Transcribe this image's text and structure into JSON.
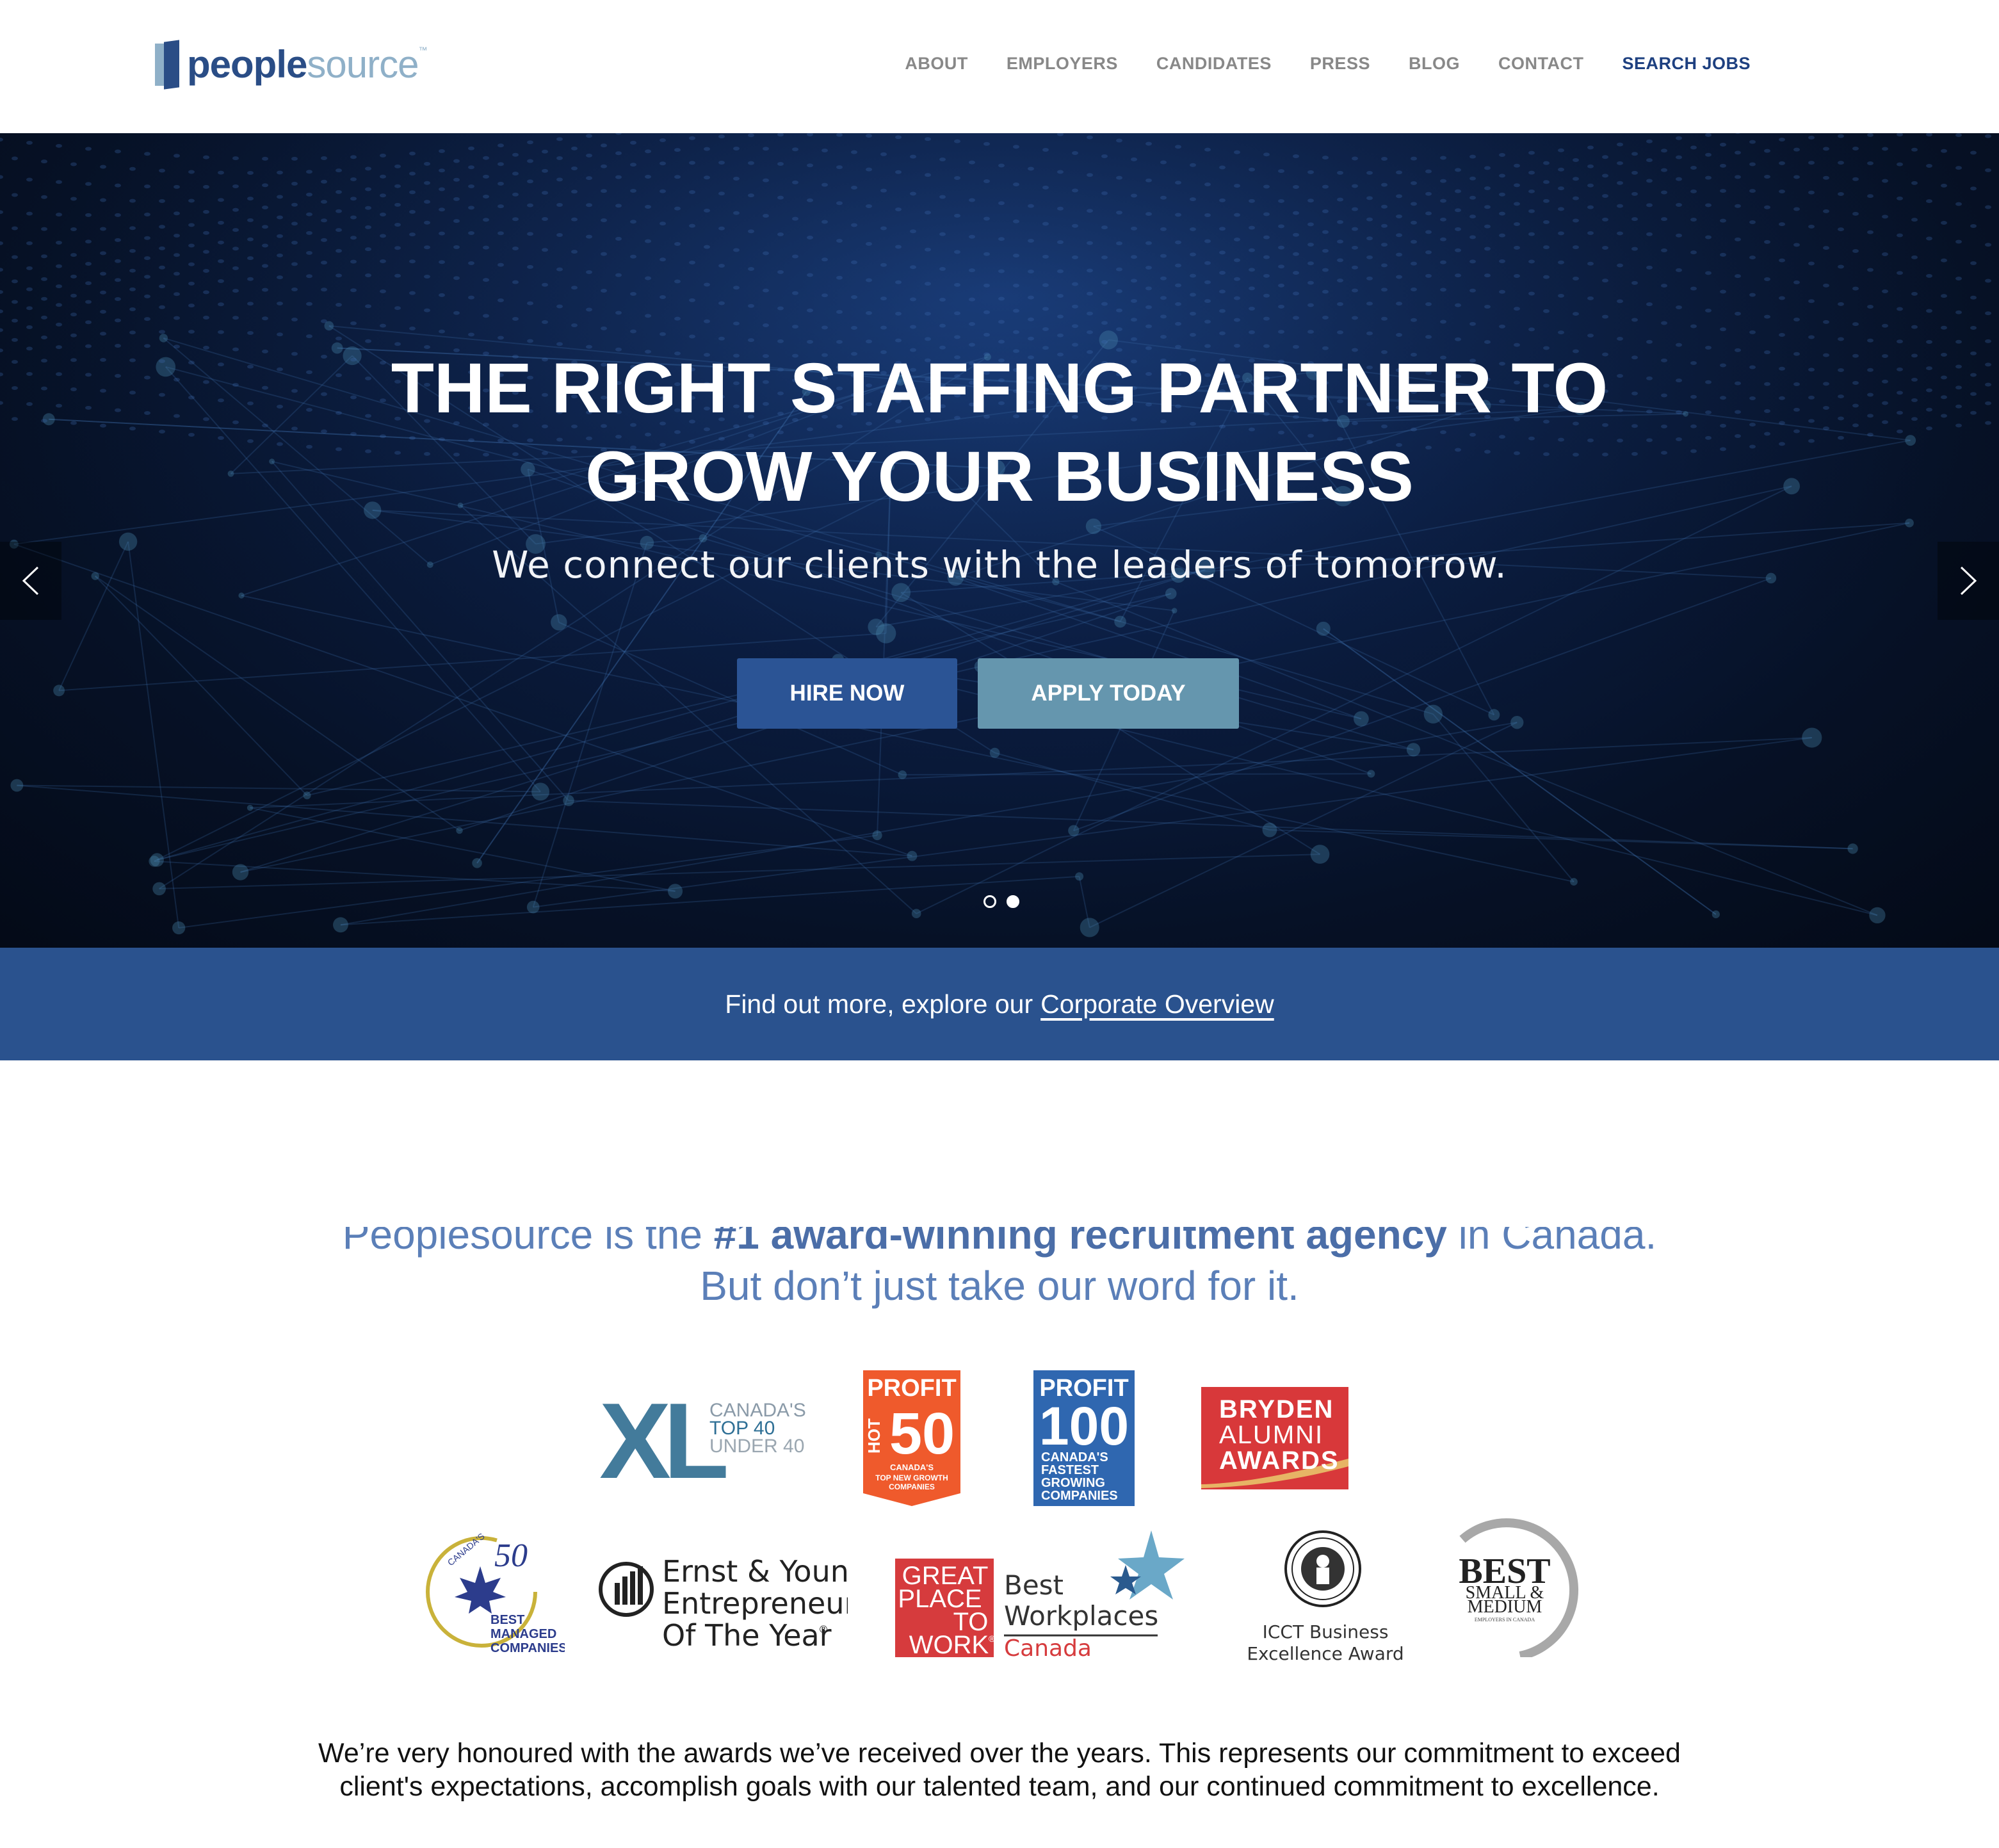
{
  "brand": {
    "name_part1": "people",
    "name_part2": "source",
    "trademark": "™"
  },
  "nav": {
    "items": [
      "ABOUT",
      "EMPLOYERS",
      "CANDIDATES",
      "PRESS",
      "BLOG",
      "CONTACT"
    ],
    "search_jobs": "SEARCH JOBS"
  },
  "hero": {
    "title_line1": "THE RIGHT STAFFING PARTNER TO",
    "title_line2": "GROW YOUR BUSINESS",
    "subtitle": "We connect our clients with the leaders of tomorrow.",
    "hire_label": "HIRE NOW",
    "apply_label": "APPLY TODAY",
    "slide_count": 2,
    "active_slide": 2
  },
  "banner": {
    "text": "Find out more, explore our",
    "link": "Corporate Overview"
  },
  "awards": {
    "heading_pre": "Peoplesource is the ",
    "heading_bold": "#1 award-winning recruitment agency",
    "heading_post": " in Canada.",
    "heading_line2": "But don’t just take our word for it.",
    "xl": {
      "mark": "XL",
      "l1": "CANADA'S",
      "l2": "TOP 40",
      "l3": "UNDER 40"
    },
    "hot50": {
      "l1": "PROFIT",
      "l2": "HOT",
      "l3": "50",
      "l4": "CANADA'S",
      "l5": "TOP NEW GROWTH",
      "l6": "COMPANIES"
    },
    "profit100": {
      "l1": "PROFIT",
      "l2": "100",
      "l3": "CANADA'S",
      "l4": "FASTEST",
      "l5": "GROWING",
      "l6": "COMPANIES"
    },
    "bryden": {
      "l1": "BRYDEN",
      "l2": "ALUMNI",
      "l3": "AWARDS"
    },
    "best50": {
      "l1": "CANADA'S",
      "l2": "50",
      "l3": "BEST",
      "l4": "MANAGED",
      "l5": "COMPANIES"
    },
    "ey": {
      "l1": "Ernst & Young",
      "l2": "Entrepreneur",
      "l3": "Of The Year",
      "reg": "®"
    },
    "gptw": {
      "l1": "GREAT",
      "l2": "PLACE",
      "l3": "TO",
      "l4": "WORK",
      "reg": "®",
      "l5": "Best",
      "l6": "Workplaces",
      "l7": "Canada"
    },
    "icct": {
      "l1": "ICCT Business",
      "l2": "Excellence Award"
    },
    "bsm": {
      "l1": "BEST",
      "l2": "SMALL &",
      "l3": "MEDIUM",
      "l4": "EMPLOYERS IN CANADA"
    }
  },
  "closing": {
    "line1": "We’re very honoured with the awards we’ve received over the years. This represents our commitment to exceed",
    "line2": "client's expectations, accomplish goals with our talented team, and our continued commitment to excellence."
  },
  "colors": {
    "brand_blue": "#2a4d86",
    "brand_light": "#8fb0c8",
    "hire_button": "#2b5495",
    "apply_button": "#6596ae",
    "banner": "#2a528e",
    "heading": "#5b7fb8"
  }
}
